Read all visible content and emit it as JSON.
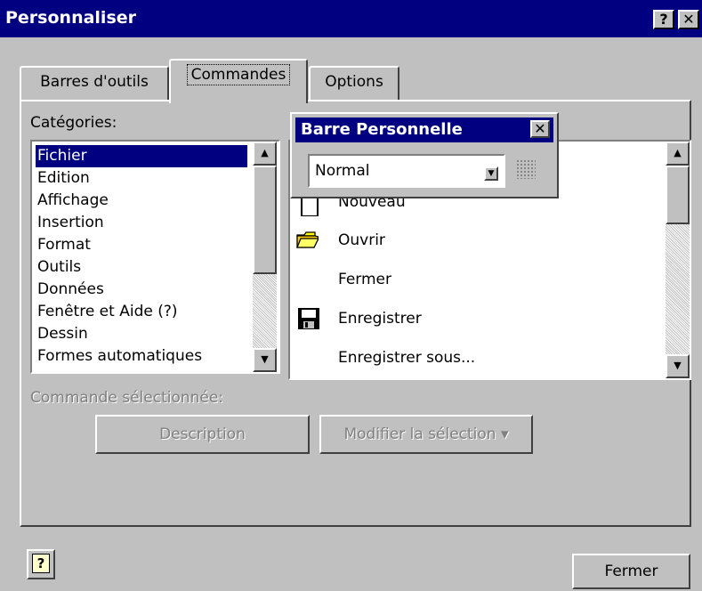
{
  "window": {
    "title": "Personnaliser",
    "help_btn": "?",
    "close_btn": "✕"
  },
  "tabs": [
    {
      "label": "Barres d'outils"
    },
    {
      "label": "Commandes"
    },
    {
      "label": "Options"
    }
  ],
  "categories": {
    "label": "Catégories:",
    "items": [
      "Fichier",
      "Edition",
      "Affichage",
      "Insertion",
      "Format",
      "Outils",
      "Données",
      "Fenêtre et Aide (?)",
      "Dessin",
      "Formes automatiques"
    ],
    "selected": "Fichier"
  },
  "commands": {
    "items": [
      "Nouveau",
      "Ouvrir",
      "Fermer",
      "Enregistrer",
      "Enregistrer sous..."
    ]
  },
  "floating_toolbar": {
    "title": "Barre Personnelle",
    "close": "✕",
    "combo_value": "Normal"
  },
  "selected_command": {
    "label": "Commande sélectionnée:",
    "description_button": "Description",
    "modify_button": "Modifier la sélection ▾"
  },
  "footer": {
    "help_icon": "?",
    "close_button": "Fermer"
  }
}
